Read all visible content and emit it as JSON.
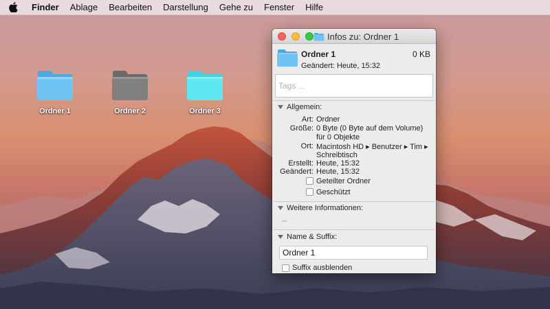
{
  "menubar": {
    "apple_icon": "apple-logo-icon",
    "items": [
      "Finder",
      "Ablage",
      "Bearbeiten",
      "Darstellung",
      "Gehe zu",
      "Fenster",
      "Hilfe"
    ]
  },
  "desktop": {
    "icons": [
      {
        "label": "Ordner 1",
        "color": "#6fc4f4"
      },
      {
        "label": "Ordner 2",
        "color": "#7f7f7f"
      },
      {
        "label": "Ordner 3",
        "color": "#5ee6f1"
      }
    ]
  },
  "info_window": {
    "title": "Infos zu: Ordner 1",
    "header": {
      "name": "Ordner 1",
      "size": "0 KB",
      "modified": "Geändert: Heute, 15:32"
    },
    "tags_placeholder": "Tags ...",
    "general": {
      "heading": "Allgemein:",
      "kind_label": "Art:",
      "kind_value": "Ordner",
      "size_label": "Größe:",
      "size_value_line1": "0 Byte (0 Byte auf dem Volume)",
      "size_value_line2": "für 0 Objekte",
      "where_label": "Ort:",
      "where_value_line1": "Macintosh HD ▸ Benutzer ▸ Tim ▸",
      "where_value_line2": "Schreibtisch",
      "created_label": "Erstellt:",
      "created_value": "Heute, 15:32",
      "modified_label": "Geändert:",
      "modified_value": "Heute, 15:32",
      "shared_folder_label": "Geteilter Ordner",
      "locked_label": "Geschützt"
    },
    "more_info": {
      "heading": "Weitere Informationen:",
      "value": "--"
    },
    "name_ext": {
      "heading": "Name & Suffix:",
      "name_value": "Ordner 1",
      "hide_ext_label": "Suffix ausblenden"
    }
  },
  "colors": {
    "folder_blue": "#6fc4f4",
    "close": "#fc605c",
    "minimize": "#fdbc40",
    "maximize": "#34c84a"
  }
}
